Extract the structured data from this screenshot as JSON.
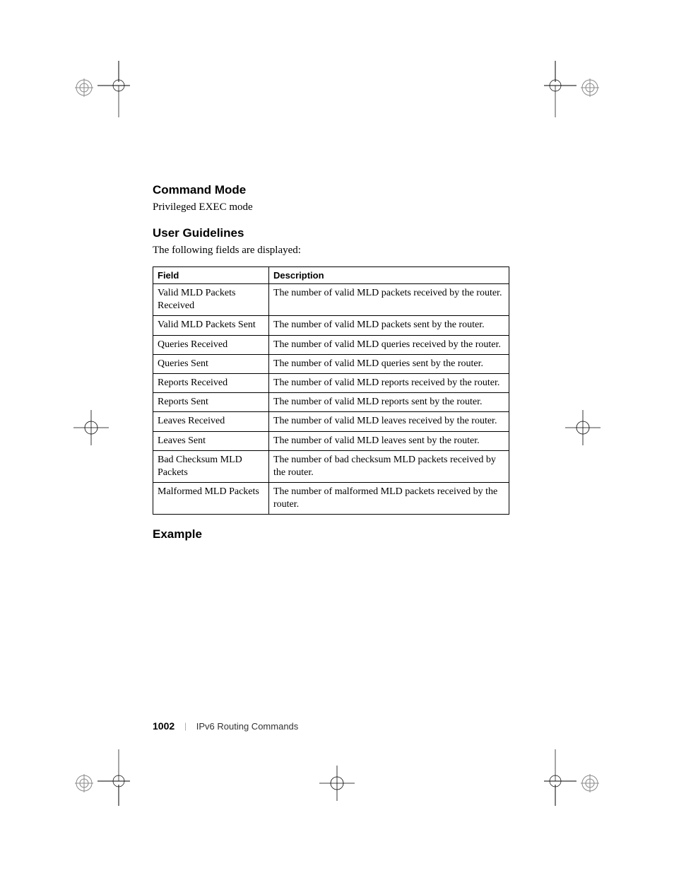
{
  "sections": {
    "command_mode": {
      "heading": "Command Mode",
      "body": "Privileged EXEC mode"
    },
    "user_guidelines": {
      "heading": "User Guidelines",
      "body": "The following fields are displayed:"
    },
    "example": {
      "heading": "Example"
    }
  },
  "table": {
    "headers": [
      "Field",
      "Description"
    ],
    "rows": [
      {
        "field": "Valid MLD Packets Received",
        "description": "The number of valid MLD packets received by the router."
      },
      {
        "field": "Valid MLD Packets Sent",
        "description": "The number of valid MLD packets sent by the router."
      },
      {
        "field": "Queries Received",
        "description": "The number of valid MLD queries received by the router."
      },
      {
        "field": "Queries Sent",
        "description": "The number of valid MLD queries sent by the router."
      },
      {
        "field": "Reports Received",
        "description": "The number of valid MLD reports received by the router."
      },
      {
        "field": "Reports Sent",
        "description": "The number of valid MLD reports sent by the router."
      },
      {
        "field": "Leaves Received",
        "description": "The number of valid MLD leaves received by the router."
      },
      {
        "field": "Leaves Sent",
        "description": "The number of valid MLD leaves sent by the router."
      },
      {
        "field": "Bad Checksum MLD Packets",
        "description": "The number of bad checksum MLD packets received by the router."
      },
      {
        "field": "Malformed MLD Packets",
        "description": "The number of malformed MLD packets received by the router."
      }
    ]
  },
  "footer": {
    "page": "1002",
    "divider": "|",
    "title": "IPv6 Routing Commands"
  }
}
